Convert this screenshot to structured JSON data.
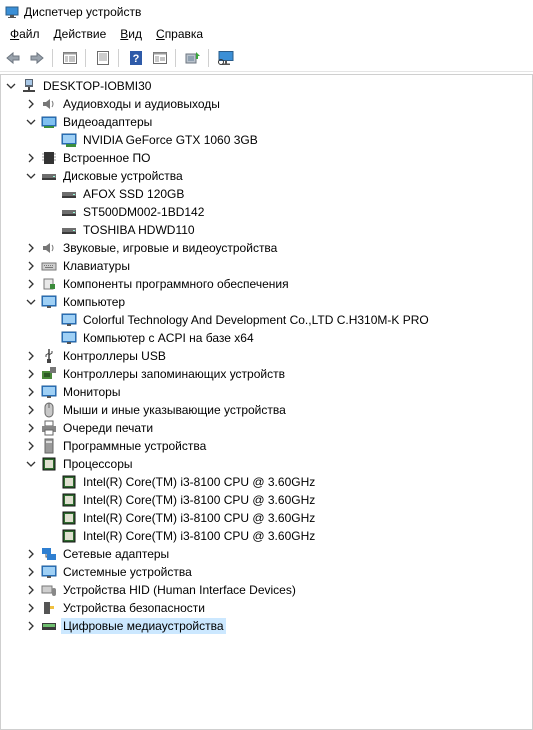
{
  "window": {
    "title": "Диспетчер устройств",
    "icon": "device-manager-icon"
  },
  "menu": [
    {
      "label_u": "Ф",
      "label_rest": "айл"
    },
    {
      "label_u": "Д",
      "label_rest": "ействие"
    },
    {
      "label_u": "В",
      "label_rest": "ид"
    },
    {
      "label_u": "С",
      "label_rest": "правка"
    }
  ],
  "toolbar": {
    "icons": [
      "back-arrow-icon",
      "forward-arrow-icon",
      "properties-icon",
      "show-hidden-icon",
      "help-icon",
      "view-icon",
      "update-driver-icon",
      "scan-hardware-icon"
    ]
  },
  "tree": {
    "root": "DESKTOP-IOBMI30",
    "categories": [
      {
        "label": "Аудиовходы и аудиовыходы",
        "icon": "speaker-icon",
        "expanded": false
      },
      {
        "label": "Видеоадаптеры",
        "icon": "display-adapter-icon",
        "expanded": true,
        "children": [
          "NVIDIA GeForce GTX 1060 3GB"
        ]
      },
      {
        "label": "Встроенное ПО",
        "icon": "firmware-icon",
        "expanded": false
      },
      {
        "label": "Дисковые устройства",
        "icon": "disk-drive-icon",
        "expanded": true,
        "children": [
          "AFOX SSD 120GB",
          "ST500DM002-1BD142",
          "TOSHIBA HDWD110"
        ]
      },
      {
        "label": "Звуковые, игровые и видеоустройства",
        "icon": "sound-icon",
        "expanded": false
      },
      {
        "label": "Клавиатуры",
        "icon": "keyboard-icon",
        "expanded": false
      },
      {
        "label": "Компоненты программного обеспечения",
        "icon": "software-component-icon",
        "expanded": false
      },
      {
        "label": "Компьютер",
        "icon": "computer-icon",
        "expanded": true,
        "children": [
          "Colorful Technology And Development Co.,LTD C.H310M-K PRO",
          "Компьютер с ACPI на базе x64"
        ]
      },
      {
        "label": "Контроллеры USB",
        "icon": "usb-icon",
        "expanded": false
      },
      {
        "label": "Контроллеры запоминающих устройств",
        "icon": "storage-controller-icon",
        "expanded": false
      },
      {
        "label": "Мониторы",
        "icon": "monitor-icon",
        "expanded": false
      },
      {
        "label": "Мыши и иные указывающие устройства",
        "icon": "mouse-icon",
        "expanded": false
      },
      {
        "label": "Очереди печати",
        "icon": "printer-icon",
        "expanded": false
      },
      {
        "label": "Программные устройства",
        "icon": "software-device-icon",
        "expanded": false
      },
      {
        "label": "Процессоры",
        "icon": "processor-icon",
        "expanded": true,
        "children": [
          "Intel(R) Core(TM) i3-8100 CPU @ 3.60GHz",
          "Intel(R) Core(TM) i3-8100 CPU @ 3.60GHz",
          "Intel(R) Core(TM) i3-8100 CPU @ 3.60GHz",
          "Intel(R) Core(TM) i3-8100 CPU @ 3.60GHz"
        ]
      },
      {
        "label": "Сетевые адаптеры",
        "icon": "network-adapter-icon",
        "expanded": false
      },
      {
        "label": "Системные устройства",
        "icon": "system-device-icon",
        "expanded": false
      },
      {
        "label": "Устройства HID (Human Interface Devices)",
        "icon": "hid-icon",
        "expanded": false
      },
      {
        "label": "Устройства безопасности",
        "icon": "security-device-icon",
        "expanded": false
      },
      {
        "label": "Цифровые медиаустройства",
        "icon": "media-device-icon",
        "expanded": false,
        "selected": true
      }
    ]
  }
}
